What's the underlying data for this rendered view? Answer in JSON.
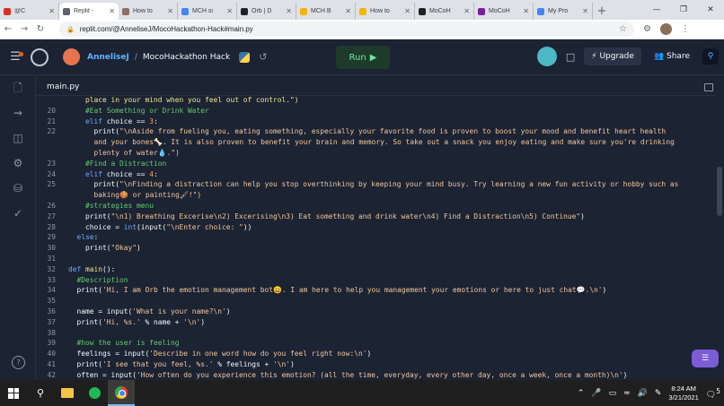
{
  "browser": {
    "tabs": [
      {
        "label": "@C",
        "color": "#d93025"
      },
      {
        "label": "Replit -",
        "color": "#5f6368",
        "active": true
      },
      {
        "label": "How to",
        "color": "#8d6e63"
      },
      {
        "label": "MCH si",
        "color": "#4285f4"
      },
      {
        "label": "Orb | D",
        "color": "#202124"
      },
      {
        "label": "MCH B",
        "color": "#f4b400"
      },
      {
        "label": "How to",
        "color": "#f4b400"
      },
      {
        "label": "MoCoH",
        "color": "#202124"
      },
      {
        "label": "MoCoH",
        "color": "#7b1fa2"
      },
      {
        "label": "My Pro",
        "color": "#4285f4"
      }
    ],
    "url": "replit.com/@AnneliseJ/MocoHackathon-Hack#main.py"
  },
  "header": {
    "username": "AnneliseJ",
    "separator": "/",
    "project": "MocoHackathon Hack",
    "run_label": "Run",
    "upgrade_label": "Upgrade",
    "share_label": "Share"
  },
  "editor": {
    "file_tab": "main.py"
  },
  "code_lines": [
    {
      "n": "",
      "html": "    <span class='fn'>place in your mind when you feel out of control.\")</span>"
    },
    {
      "n": "20",
      "html": "    <span class='cmt'>#Eat Something or Drink Water</span>"
    },
    {
      "n": "21",
      "html": "    <span class='kw'>elif</span> choice == <span class='nb'>3</span>:"
    },
    {
      "n": "22",
      "html": "      print(<span class='str'>\"\\nAside from fueling you, eating something, especially your favorite food is proven to boost your mood and benefit heart health</span>"
    },
    {
      "n": "",
      "html": "      <span class='str'>and your bones🦴. It is also proven to benefit your brain and memory. So take out a snack you enjoy eating and make sure you're drinking</span>"
    },
    {
      "n": "",
      "html": "      <span class='str'>plenty of water💧.\")</span>"
    },
    {
      "n": "23",
      "html": "    <span class='cmt'>#Find a Distraction</span>"
    },
    {
      "n": "24",
      "html": "    <span class='kw'>elif</span> choice == <span class='nb'>4</span>:"
    },
    {
      "n": "25",
      "html": "      print(<span class='str'>\"\\nFinding a distraction can help you stop overthinking by keeping your mind busy. Try learning a new fun activity or hobby such as</span>"
    },
    {
      "n": "",
      "html": "      <span class='str'>baking🍪 or painting🖌!\")</span>"
    },
    {
      "n": "26",
      "html": "    <span class='cmt'>#strategies menu</span>"
    },
    {
      "n": "27",
      "html": "    print(<span class='str'>\"\\n1) Breathing Excerise\\n2) Excerising\\n3) Eat something and drink water\\n4) Find a Distraction\\n5) Continue\"</span>)"
    },
    {
      "n": "28",
      "html": "    choice = <span class='kw'>int</span>(input(<span class='str'>\"\\nEnter choice: \"</span>))"
    },
    {
      "n": "29",
      "html": "  <span class='kw'>else</span>:"
    },
    {
      "n": "30",
      "html": "    print(<span class='str'>\"Okay\"</span>)"
    },
    {
      "n": "31",
      "html": ""
    },
    {
      "n": "32",
      "html": "<span class='kw'>def</span> <span class='fn'>main</span>():"
    },
    {
      "n": "33",
      "html": "  <span class='cmt'>#Description</span>"
    },
    {
      "n": "34",
      "html": "  print(<span class='str'>'Hi, I am Orb the emotion management bot😀. I am here to help you management your emotions or here to just chat💬.\\n'</span>)"
    },
    {
      "n": "35",
      "html": ""
    },
    {
      "n": "36",
      "html": "  name = input(<span class='str'>'What is your name?\\n'</span>)"
    },
    {
      "n": "37",
      "html": "  print(<span class='str'>'Hi, %s.'</span> % name + <span class='str'>'\\n'</span>)"
    },
    {
      "n": "38",
      "html": ""
    },
    {
      "n": "39",
      "html": "  <span class='cmt'>#how the user is feeling</span>"
    },
    {
      "n": "40",
      "html": "  feelings = input(<span class='str'>'Describe in one word how do you feel right now:\\n'</span>)"
    },
    {
      "n": "41",
      "html": "  print(<span class='str'>'I see that you feel, %s.'</span> % feelings + <span class='str'>'\\n'</span>)"
    },
    {
      "n": "42",
      "html": "  often = input(<span class='str'>'How often do you experience this emotion? (all the time, everyday, every other day, once a week, once a month)\\n'</span>)"
    }
  ],
  "taskbar": {
    "time": "8:24 AM",
    "date": "3/21/2021",
    "notification_count": "5"
  }
}
